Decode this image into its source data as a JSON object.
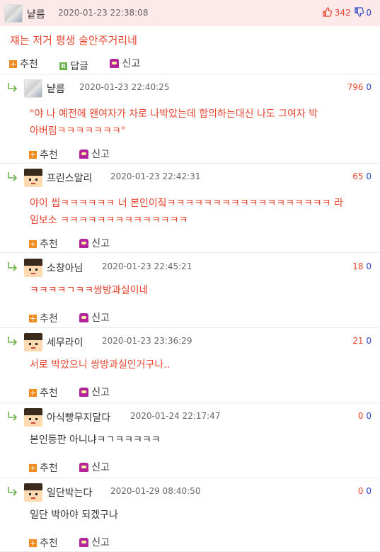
{
  "post": {
    "author": "냩름",
    "date": "2020-01-23 22:38:08",
    "up_count": "342",
    "down_count": "0",
    "text": "쟤는 저거 평생 술안주거리네",
    "recommend_label": "추천",
    "reply_label": "답글",
    "report_label": "신고",
    "reply_icon_letter": "R"
  },
  "comments": [
    {
      "author": "냩름",
      "date": "2020-01-23 22:40:25",
      "up": "796",
      "down": "0",
      "lines": [
        "\"야 나 예전에 왠여자가 차로 나박았는데 합의하는대신 나도 그여자 박",
        "아버림ㅋㅋㅋㅋㅋㅋㅋ\""
      ],
      "recommend_label": "추천",
      "report_label": "신고",
      "avatar": "photo"
    },
    {
      "author": "프린스알리",
      "date": "2020-01-23 22:42:31",
      "up": "65",
      "down": "0",
      "lines": [
        "야이 씹ㅋㅋㅋㅋㅋㅋ 너 본인이짘ㅋㅋㅋㅋㅋㅋㅋㅋㅋㅋㅋㅋㅋㅋㅋㅋㅋㅋ 라",
        "임보소 ㅋㅋㅋㅋㅋㅋㅋㅋㅋㅋㅋㅋㅋㅋ"
      ],
      "recommend_label": "추천",
      "report_label": "신고",
      "avatar": "pixel"
    },
    {
      "author": "소창아님",
      "date": "2020-01-23 22:45:21",
      "up": "18",
      "down": "0",
      "lines": [
        "ㅋㅋㅋㅋㄱㅋㅋ쌍방과실이네"
      ],
      "recommend_label": "추천",
      "report_label": "신고",
      "avatar": "pixel"
    },
    {
      "author": "세무라이",
      "date": "2020-01-23 23:36:29",
      "up": "21",
      "down": "0",
      "lines": [
        "서로 박았으니 쌍방과실인거구나.."
      ],
      "recommend_label": "추천",
      "report_label": "신고",
      "avatar": "pixel"
    },
    {
      "author": "아식빵무지달다",
      "date": "2020-01-24 22:17:47",
      "up": "0",
      "down": "0",
      "lines": [
        "본인등판 아니냐ㅋㄱㅋㅋㅋㅋㅋ"
      ],
      "recommend_label": "추천",
      "report_label": "신고",
      "avatar": "pixel"
    },
    {
      "author": "일단박는다",
      "date": "2020-01-29 08:40:50",
      "up": "0",
      "down": "0",
      "lines": [
        "일단 박아야 되겠구나"
      ],
      "recommend_label": "추천",
      "report_label": "신고",
      "avatar": "pixel"
    }
  ],
  "colors": {
    "accent_red": "#e8442e",
    "down_blue": "#2947c7",
    "header_bg": "#fde9e9",
    "recommend_orange": "#f08a1c",
    "report_purple": "#b3249a",
    "reply_green": "#6bb34a"
  }
}
